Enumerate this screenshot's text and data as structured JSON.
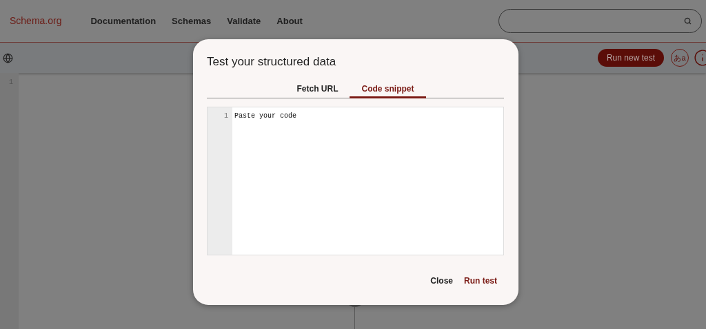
{
  "header": {
    "logo": "Schema.org",
    "nav": [
      "Documentation",
      "Schemas",
      "Validate",
      "About"
    ]
  },
  "toolbar": {
    "run_new_test": "Run new test",
    "language_button": "あa"
  },
  "editor": {
    "line_numbers": [
      "1"
    ]
  },
  "dialog": {
    "title": "Test your structured data",
    "tabs": [
      {
        "label": "Fetch URL",
        "selected": false
      },
      {
        "label": "Code snippet",
        "selected": true
      }
    ],
    "code": {
      "line_numbers": [
        "1"
      ],
      "placeholder": "Paste your code"
    },
    "buttons": [
      {
        "label": "Close",
        "kind": "secondary"
      },
      {
        "label": "Run test",
        "kind": "primary"
      }
    ]
  }
}
